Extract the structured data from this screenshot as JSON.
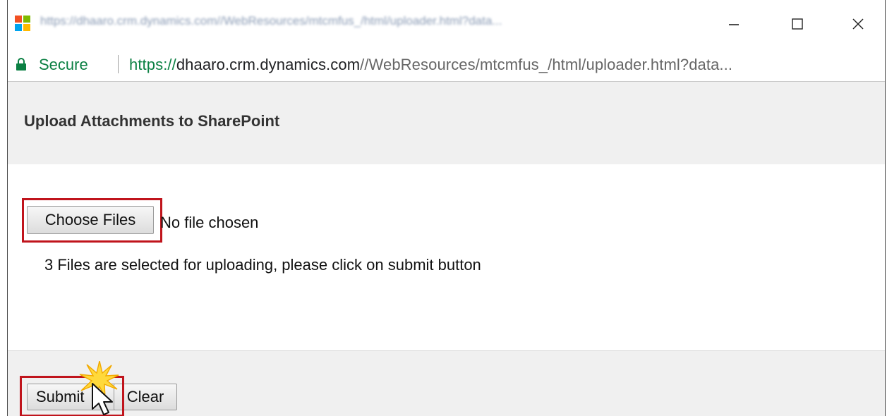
{
  "window": {
    "title": "https://dhaaro.crm.dynamics.com//WebResources/mtcmfus_/html/uploader.html?data...",
    "controls": {
      "minimize": "—",
      "maximize": "☐",
      "close": "✕"
    }
  },
  "address": {
    "secure_label": "Secure",
    "url_scheme": "https://",
    "url_host": "dhaaro.crm.dynamics.com",
    "url_path": "//WebResources/mtcmfus_/html/uploader.html?data..."
  },
  "page": {
    "title": "Upload Attachments to SharePoint"
  },
  "upload": {
    "choose_label": "Choose Files",
    "no_file_text": "No file chosen",
    "status_message": "3 Files are selected for uploading, please click on submit button"
  },
  "footer": {
    "submit_label": "Submit",
    "clear_label": "Clear"
  },
  "colors": {
    "secure_green": "#0b8043",
    "highlight_red": "#c0141c",
    "panel_gray": "#f0f0f0"
  },
  "icons": {
    "app": "microsoft-logo-icon",
    "lock": "lock-icon",
    "cursor": "mouse-pointer-icon",
    "click": "click-burst-icon"
  }
}
